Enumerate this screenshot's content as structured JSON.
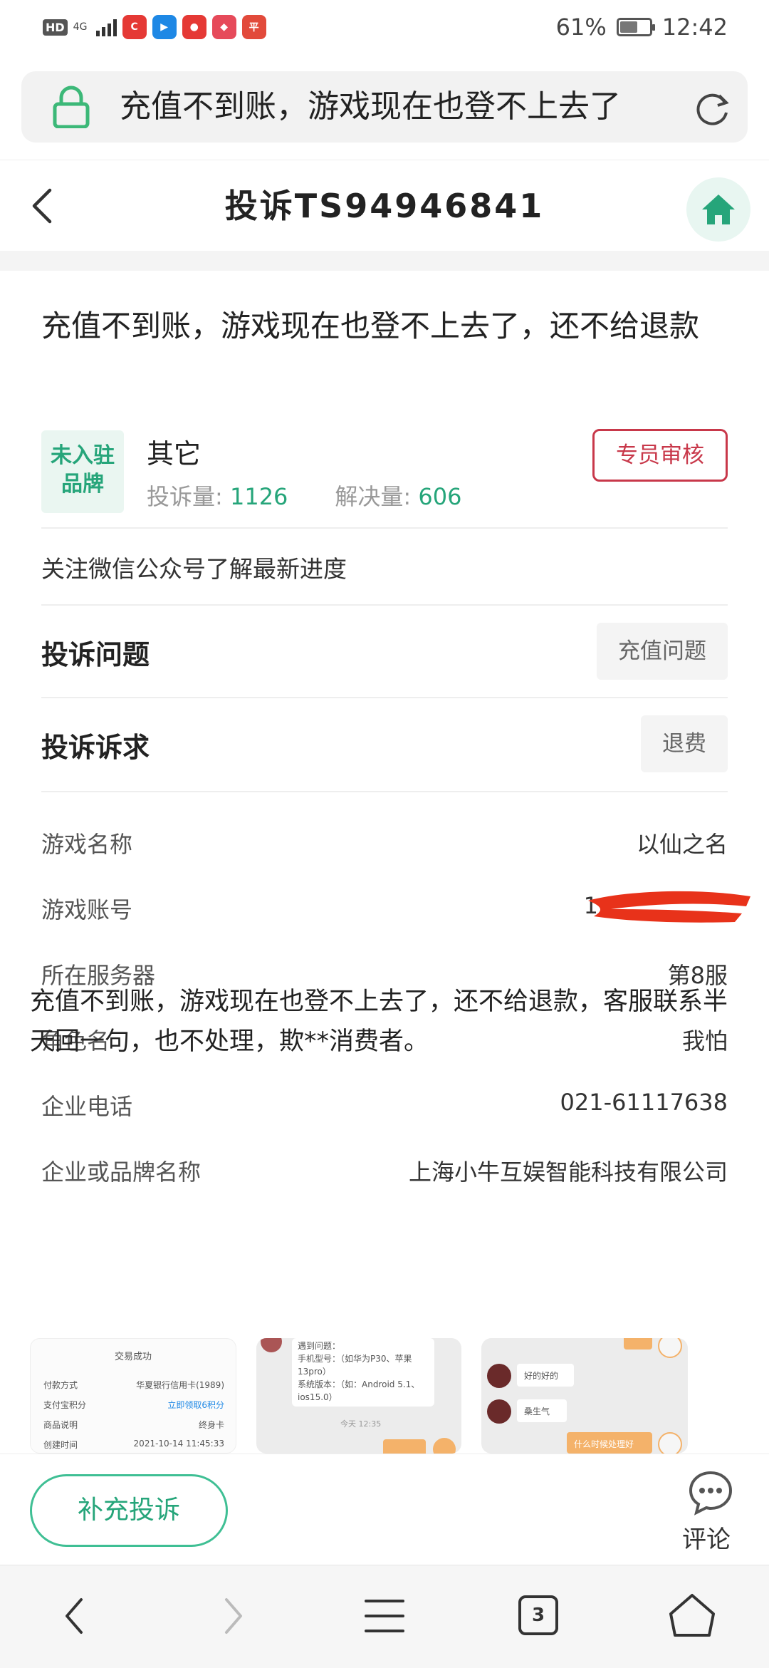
{
  "status_bar": {
    "hd": "HD",
    "network": "4G",
    "battery_percent_text": "61%",
    "battery_level": 0.61,
    "time": "12:42",
    "app_icons": [
      {
        "name": "c-app-icon",
        "color": "#e53935",
        "glyph": "C"
      },
      {
        "name": "youku-icon",
        "color": "#1e88e5",
        "glyph": "▶"
      },
      {
        "name": "weibo-icon",
        "color": "#e53935",
        "glyph": "●"
      },
      {
        "name": "huawei-icon",
        "color": "#e64a5a",
        "glyph": "◆"
      },
      {
        "name": "pingan-icon",
        "color": "#e24a3b",
        "glyph": "平"
      }
    ]
  },
  "url_bar": {
    "text": "充值不到账，游戏现在也登不上去了"
  },
  "header": {
    "title": "投诉TS94946841"
  },
  "complaint": {
    "title": "充值不到账，游戏现在也登不上去了，还不给退款",
    "brand_badge": "未入驻品牌",
    "brand_name": "其它",
    "complaint_count_label": "投诉量: ",
    "complaint_count": "1126",
    "resolved_count_label": "解决量: ",
    "resolved_count": "606",
    "review_button": "专员审核",
    "follow_text": "关注微信公众号了解最新进度",
    "issue_label": "投诉问题",
    "issue_tag": "充值问题",
    "demand_label": "投诉诉求",
    "demand_tag": "退费",
    "details": [
      {
        "label": "游戏名称",
        "value": "以仙之名"
      },
      {
        "label": "游戏账号",
        "value": "1"
      },
      {
        "label": "所在服务器",
        "value": "第8服"
      },
      {
        "label": "角色名",
        "value": "我怕"
      },
      {
        "label": "企业电话",
        "value": "021-61117638"
      },
      {
        "label": "企业或品牌名称",
        "value": "上海小牛互娱智能科技有限公司"
      }
    ],
    "description": "充值不到账，游戏现在也登不上去了，还不给退款，客服联系半天回一句，也不处理，欺**消费者。"
  },
  "thumbnails": {
    "t1": {
      "header": "交易成功",
      "row1_label": "付款方式",
      "row1_value": "华夏银行信用卡(1989)",
      "row2_label": "支付宝积分",
      "row2_value": "立即领取6积分",
      "row3_label": "商品说明",
      "row3_value": "终身卡",
      "row4_label": "创建时间",
      "row4_value": "2021-10-14 11:45:33"
    },
    "t2": {
      "line1": "遇到问题：",
      "line2": "手机型号：（如华为P30、苹果",
      "line3": "13pro）",
      "line4": "系统版本：（如：Android 5.1、",
      "line5": "ios15.0）",
      "time": "今天 12:35"
    },
    "t3": {
      "msg1": "好的好的",
      "msg2": "桑生气",
      "msg3": "什么时候处理好"
    }
  },
  "action_bar": {
    "supplement_button": "补充投诉",
    "comment_label": "评论"
  },
  "browser_nav": {
    "tab_count": "3"
  },
  "colors": {
    "accent_green": "#26a57a",
    "review_red": "#c8384a",
    "redaction": "#e8321a"
  }
}
